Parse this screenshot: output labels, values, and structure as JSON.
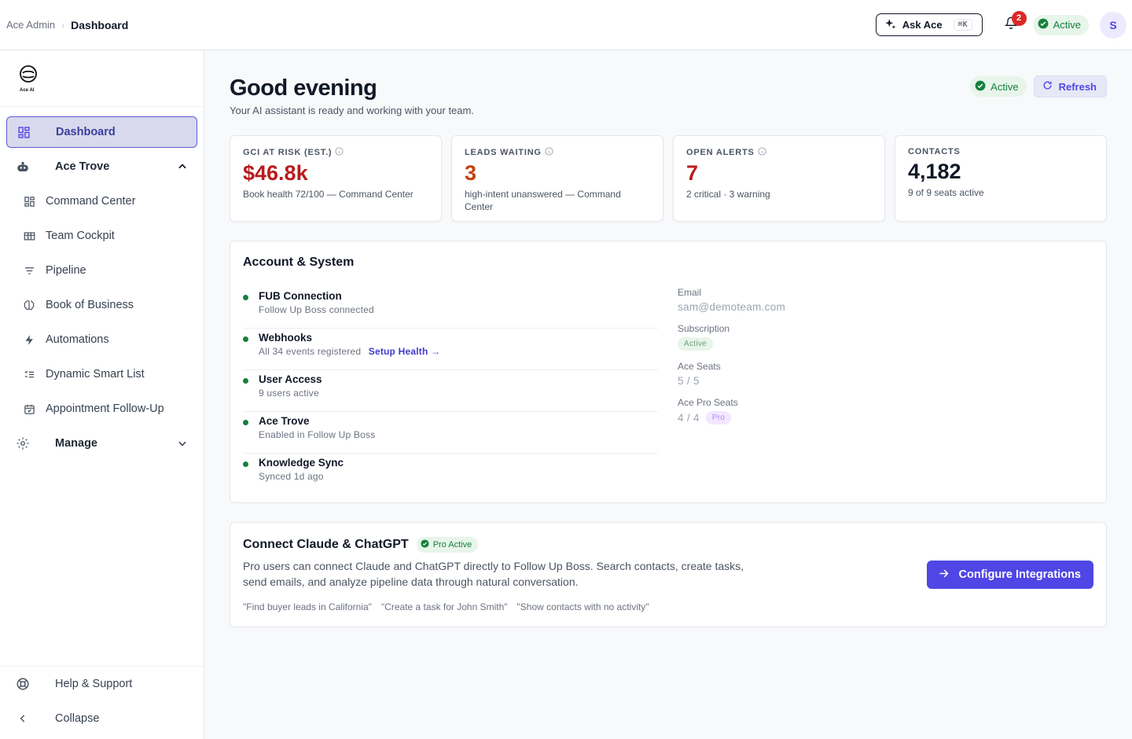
{
  "breadcrumb": {
    "root": "Ace Admin",
    "current": "Dashboard"
  },
  "topbar": {
    "ask_label": "Ask Ace",
    "ask_shortcut": "⌘K",
    "notification_count": "2",
    "status": "Active",
    "avatar_initial": "S"
  },
  "sidebar": {
    "logo_text": "Ace AI",
    "items": [
      {
        "label": "Dashboard",
        "icon": "dashboard-icon",
        "active": true
      },
      {
        "label": "Ace Trove",
        "icon": "robot-icon",
        "expanded": true
      },
      {
        "label": "Command Center",
        "icon": "grid-icon"
      },
      {
        "label": "Team Cockpit",
        "icon": "table-icon"
      },
      {
        "label": "Pipeline",
        "icon": "filter-icon"
      },
      {
        "label": "Book of Business",
        "icon": "brain-icon"
      },
      {
        "label": "Automations",
        "icon": "bolt-icon"
      },
      {
        "label": "Dynamic Smart List",
        "icon": "list-check-icon"
      },
      {
        "label": "Appointment Follow-Up",
        "icon": "calendar-check-icon"
      },
      {
        "label": "Manage",
        "icon": "gear-icon",
        "expanded": false
      }
    ],
    "bottom": [
      {
        "label": "Help & Support",
        "icon": "lifebuoy-icon"
      },
      {
        "label": "Collapse",
        "icon": "chevron-left-icon"
      }
    ]
  },
  "header": {
    "greeting": "Good evening",
    "subtitle": "Your AI assistant is ready and working with your team.",
    "status": "Active",
    "refresh_label": "Refresh"
  },
  "stats": [
    {
      "label": "GCI AT RISK (EST.)",
      "value": "$46.8k",
      "note": "Book health 72/100 — Command Center",
      "color": "#b91c1c",
      "info": true
    },
    {
      "label": "LEADS WAITING",
      "value": "3",
      "note": "high-intent unanswered — Command Center",
      "color": "#c2410c",
      "info": true
    },
    {
      "label": "OPEN ALERTS",
      "value": "7",
      "note": "2 critical · 3 warning",
      "color": "#b91c1c",
      "info": true
    },
    {
      "label": "CONTACTS",
      "value": "4,182",
      "note": "9 of 9 seats active",
      "color": "#111827",
      "info": false
    }
  ],
  "account_system": {
    "title": "Account & System",
    "items": [
      {
        "name": "FUB Connection",
        "desc": "Follow Up Boss connected"
      },
      {
        "name": "Webhooks",
        "desc": "All 34 events registered",
        "link": "Setup Health →"
      },
      {
        "name": "User Access",
        "desc": "9 users active"
      },
      {
        "name": "Ace Trove",
        "desc": "Enabled in Follow Up Boss"
      },
      {
        "name": "Knowledge Sync",
        "desc": "Synced 1d ago"
      }
    ],
    "account": {
      "email_label": "Email",
      "email": "sam@demoteam.com",
      "subscription_label": "Subscription",
      "subscription": "Active",
      "seats_label": "Ace Seats",
      "seats": "5 / 5",
      "pro_seats_label": "Ace Pro Seats",
      "pro_seats": "4 / 4",
      "pro_badge": "Pro"
    }
  },
  "connect": {
    "title": "Connect Claude & ChatGPT",
    "badge": "Pro Active",
    "description": "Pro users can connect Claude and ChatGPT directly to Follow Up Boss. Search contacts, create tasks, send emails, and analyze pipeline data through natural conversation.",
    "examples": [
      "\"Find buyer leads in California\"",
      "\"Create a task for John Smith\"",
      "\"Show contacts with no activity\""
    ],
    "button_label": "Configure Integrations"
  },
  "colors": {
    "accent": "#4f46e5",
    "success": "#15803d",
    "danger": "#b91c1c",
    "warning": "#c2410c"
  }
}
